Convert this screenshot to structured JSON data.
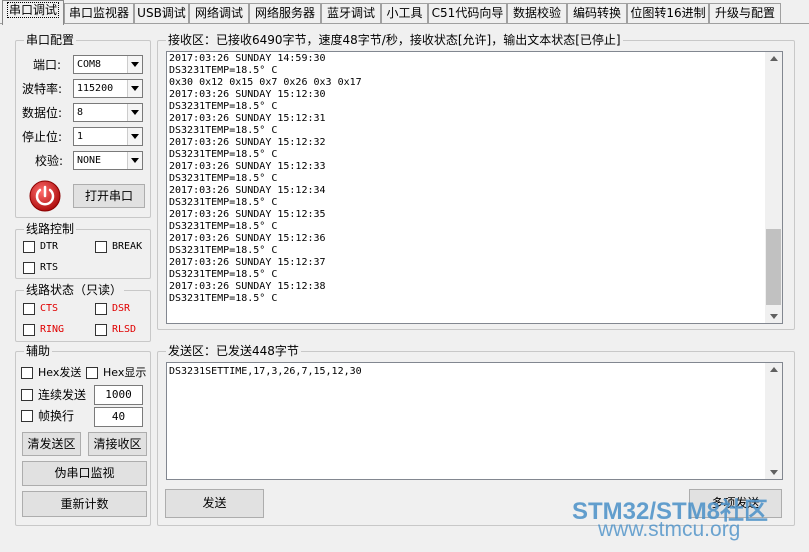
{
  "tabs": [
    "串口调试",
    "串口监视器",
    "USB调试",
    "网络调试",
    "网络服务器",
    "蓝牙调试",
    "小工具",
    "C51代码向导",
    "数据校验",
    "编码转换",
    "位图转16进制",
    "升级与配置"
  ],
  "serial_config": {
    "legend": "串口配置",
    "port_label": "端口:",
    "port_value": "COM8",
    "baud_label": "波特率:",
    "baud_value": "115200",
    "databits_label": "数据位:",
    "databits_value": "8",
    "stopbits_label": "停止位:",
    "stopbits_value": "1",
    "parity_label": "校验:",
    "parity_value": "NONE",
    "open_button": "打开串口"
  },
  "line_control": {
    "legend": "线路控制",
    "dtr": "DTR",
    "break": "BREAK",
    "rts": "RTS"
  },
  "line_status": {
    "legend": "线路状态（只读）",
    "cts": "CTS",
    "dsr": "DSR",
    "ring": "RING",
    "rlsd": "RLSD"
  },
  "aux": {
    "legend": "辅助",
    "hex_send": "Hex发送",
    "hex_show": "Hex显示",
    "continuous_send": "连续发送",
    "continuous_value": "1000",
    "frame_newline": "帧换行",
    "frame_value": "40",
    "clear_send": "清发送区",
    "clear_recv": "清接收区",
    "fake_monitor": "伪串口监视",
    "recount": "重新计数"
  },
  "receive": {
    "legend": "接收区：已接收6490字节，速度48字节/秒，接收状态[允许]，输出文本状态[已停止]",
    "lines": [
      "2017:03:26 SUNDAY 14:59:30",
      "DS3231TEMP=18.5° C",
      "0x30 0x12 0x15 0x7 0x26 0x3 0x17",
      "2017:03:26 SUNDAY 15:12:30",
      "DS3231TEMP=18.5° C",
      "2017:03:26 SUNDAY 15:12:31",
      "DS3231TEMP=18.5° C",
      "2017:03:26 SUNDAY 15:12:32",
      "DS3231TEMP=18.5° C",
      "2017:03:26 SUNDAY 15:12:33",
      "DS3231TEMP=18.5° C",
      "2017:03:26 SUNDAY 15:12:34",
      "DS3231TEMP=18.5° C",
      "2017:03:26 SUNDAY 15:12:35",
      "DS3231TEMP=18.5° C",
      "2017:03:26 SUNDAY 15:12:36",
      "DS3231TEMP=18.5° C",
      "2017:03:26 SUNDAY 15:12:37",
      "DS3231TEMP=18.5° C",
      "2017:03:26 SUNDAY 15:12:38",
      "DS3231TEMP=18.5° C"
    ]
  },
  "send": {
    "legend": "发送区：已发送448字节",
    "text": "DS3231SETTIME,17,3,26,7,15,12,30",
    "send_button": "发送",
    "multi_send_button": "多项发送"
  },
  "watermark": {
    "brand": "STM32/STM8社区",
    "url": "www.stmcu.org"
  },
  "colors": {
    "status_red": "#e00000",
    "power_red": "#d42020",
    "watermark_blue": "#4a90c8"
  }
}
